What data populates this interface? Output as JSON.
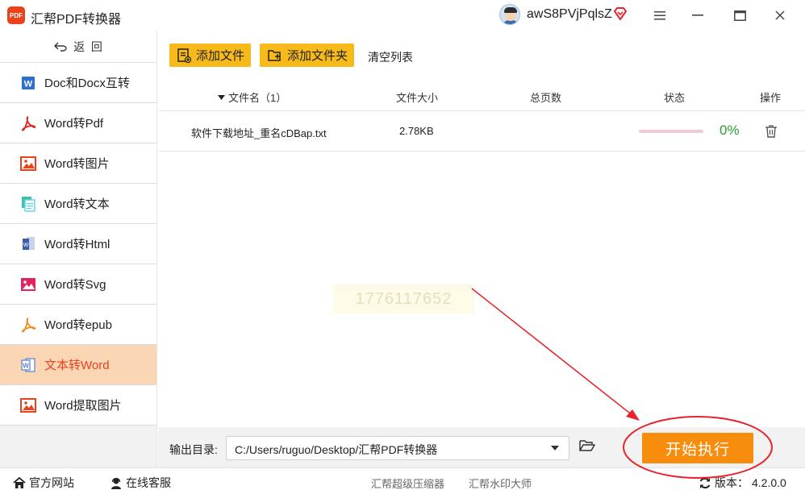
{
  "app": {
    "title": "汇帮PDF转换器",
    "logo_text": "PDF"
  },
  "user": {
    "name": "awS8PVjPqlsZ"
  },
  "colors": {
    "accent": "#f88c0c",
    "toolbar_button": "#f8b91b",
    "active_bg": "#fbd6b4",
    "active_text": "#e8431c",
    "percent_green": "#27a12e",
    "annotation_red": "#e8232a"
  },
  "sidebar": {
    "back_label": "返  回",
    "items": [
      {
        "label": "Doc和Docx互转",
        "icon": "word-doc-icon"
      },
      {
        "label": "Word转Pdf",
        "icon": "pdf-acrobat-icon"
      },
      {
        "label": "Word转图片",
        "icon": "image-icon"
      },
      {
        "label": "Word转文本",
        "icon": "text-doc-icon"
      },
      {
        "label": "Word转Html",
        "icon": "html-doc-icon"
      },
      {
        "label": "Word转Svg",
        "icon": "svg-image-icon"
      },
      {
        "label": "Word转epub",
        "icon": "epub-acrobat-icon"
      },
      {
        "label": "文本转Word",
        "icon": "word-doc-outline-icon",
        "active": true
      },
      {
        "label": "Word提取图片",
        "icon": "extract-image-icon"
      }
    ]
  },
  "toolbar": {
    "add_file": "添加文件",
    "add_folder": "添加文件夹",
    "clear_list": "清空列表"
  },
  "table": {
    "headers": {
      "name": "文件名（1）",
      "size": "文件大小",
      "pages": "总页数",
      "status": "状态",
      "action": "操作"
    },
    "rows": [
      {
        "name": "软件下载地址_重名cDBap.txt",
        "size": "2.78KB",
        "pages": "",
        "progress": 0,
        "percent": "0%"
      }
    ]
  },
  "watermark": "1776117652",
  "output": {
    "label": "输出目录:",
    "path": "C:/Users/ruguo/Desktop/汇帮PDF转换器",
    "start_label": "开始执行"
  },
  "footer": {
    "website": "官方网站",
    "support": "在线客服",
    "link1": "汇帮超级压缩器",
    "link2": "汇帮水印大师",
    "version_label": "版本：",
    "version": "4.2.0.0"
  }
}
